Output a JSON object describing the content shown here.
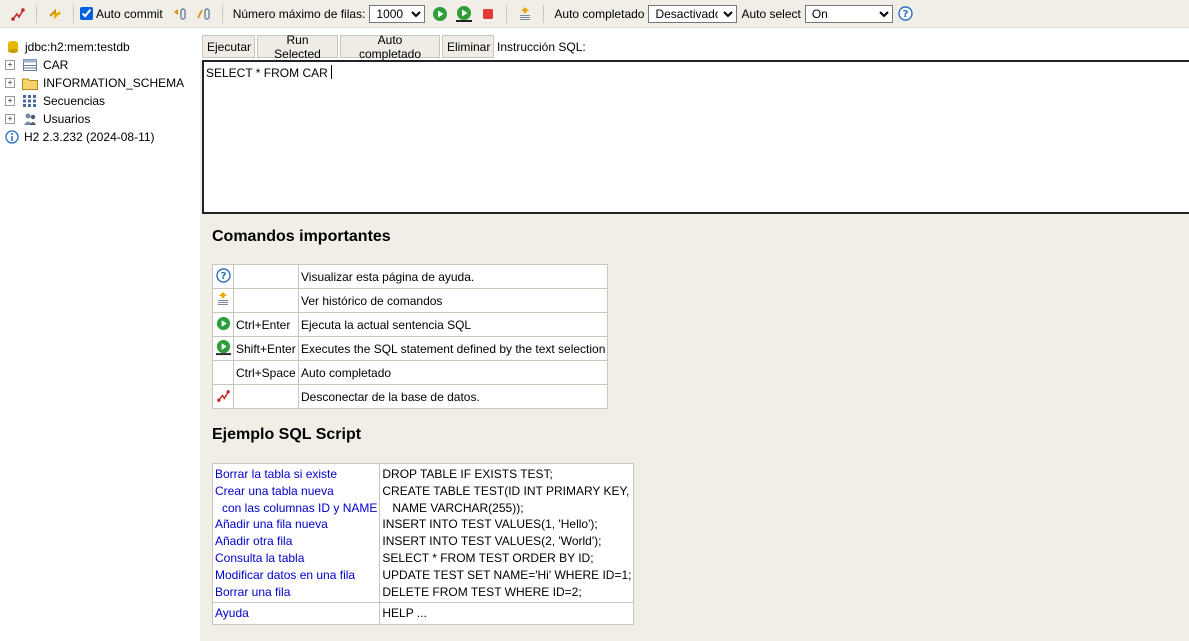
{
  "toolbar": {
    "auto_commit_label": "Auto commit",
    "auto_commit_checked": true,
    "max_rows_label": "Número máximo de filas:",
    "max_rows_value": "1000",
    "autocomplete_label": "Auto completado",
    "autocomplete_value": "Desactivado",
    "autoselect_label": "Auto select",
    "autoselect_value": "On"
  },
  "sidebar": {
    "connection": "jdbc:h2:mem:testdb",
    "items": [
      {
        "label": "CAR",
        "icon": "table-icon"
      },
      {
        "label": "INFORMATION_SCHEMA",
        "icon": "folder-icon"
      },
      {
        "label": "Secuencias",
        "icon": "sequence-icon"
      },
      {
        "label": "Usuarios",
        "icon": "users-icon"
      }
    ],
    "version": "H2 2.3.232 (2024-08-11)"
  },
  "buttons": {
    "execute": "Ejecutar",
    "run_selected": "Run Selected",
    "autocomplete": "Auto completado",
    "clear": "Eliminar",
    "sql_label": "Instrucción SQL:"
  },
  "editor": {
    "text": "SELECT * FROM CAR"
  },
  "help": {
    "title": "Comandos importantes",
    "commands": [
      {
        "icon": "help-icon",
        "key": "",
        "desc": "Visualizar esta página de ayuda."
      },
      {
        "icon": "history-icon",
        "key": "",
        "desc": "Ver histórico de comandos"
      },
      {
        "icon": "run-icon",
        "key": "Ctrl+Enter",
        "desc": "Ejecuta la actual sentencia SQL"
      },
      {
        "icon": "run-selected-icon",
        "key": "Shift+Enter",
        "desc": "Executes the SQL statement defined by the text selection"
      },
      {
        "icon": "",
        "key": "Ctrl+Space",
        "desc": "Auto completado"
      },
      {
        "icon": "disconnect-icon",
        "key": "",
        "desc": "Desconectar de la base de datos."
      }
    ],
    "example_title": "Ejemplo SQL Script",
    "example_links": [
      "Borrar la tabla si existe",
      "Crear una tabla nueva",
      "con las columnas ID y NAME",
      "Añadir una fila nueva",
      "Añadir otra fila",
      "Consulta la tabla",
      "Modificar datos en una fila",
      "Borrar una fila"
    ],
    "example_code": [
      "DROP TABLE IF EXISTS TEST;",
      "CREATE TABLE TEST(ID INT PRIMARY KEY,",
      "NAME VARCHAR(255));",
      "INSERT INTO TEST VALUES(1, 'Hello');",
      "INSERT INTO TEST VALUES(2, 'World');",
      "SELECT * FROM TEST ORDER BY ID;",
      "UPDATE TEST SET NAME='Hi' WHERE ID=1;",
      "DELETE FROM TEST WHERE ID=2;"
    ],
    "help_link": "Ayuda",
    "help_code": "HELP ..."
  }
}
